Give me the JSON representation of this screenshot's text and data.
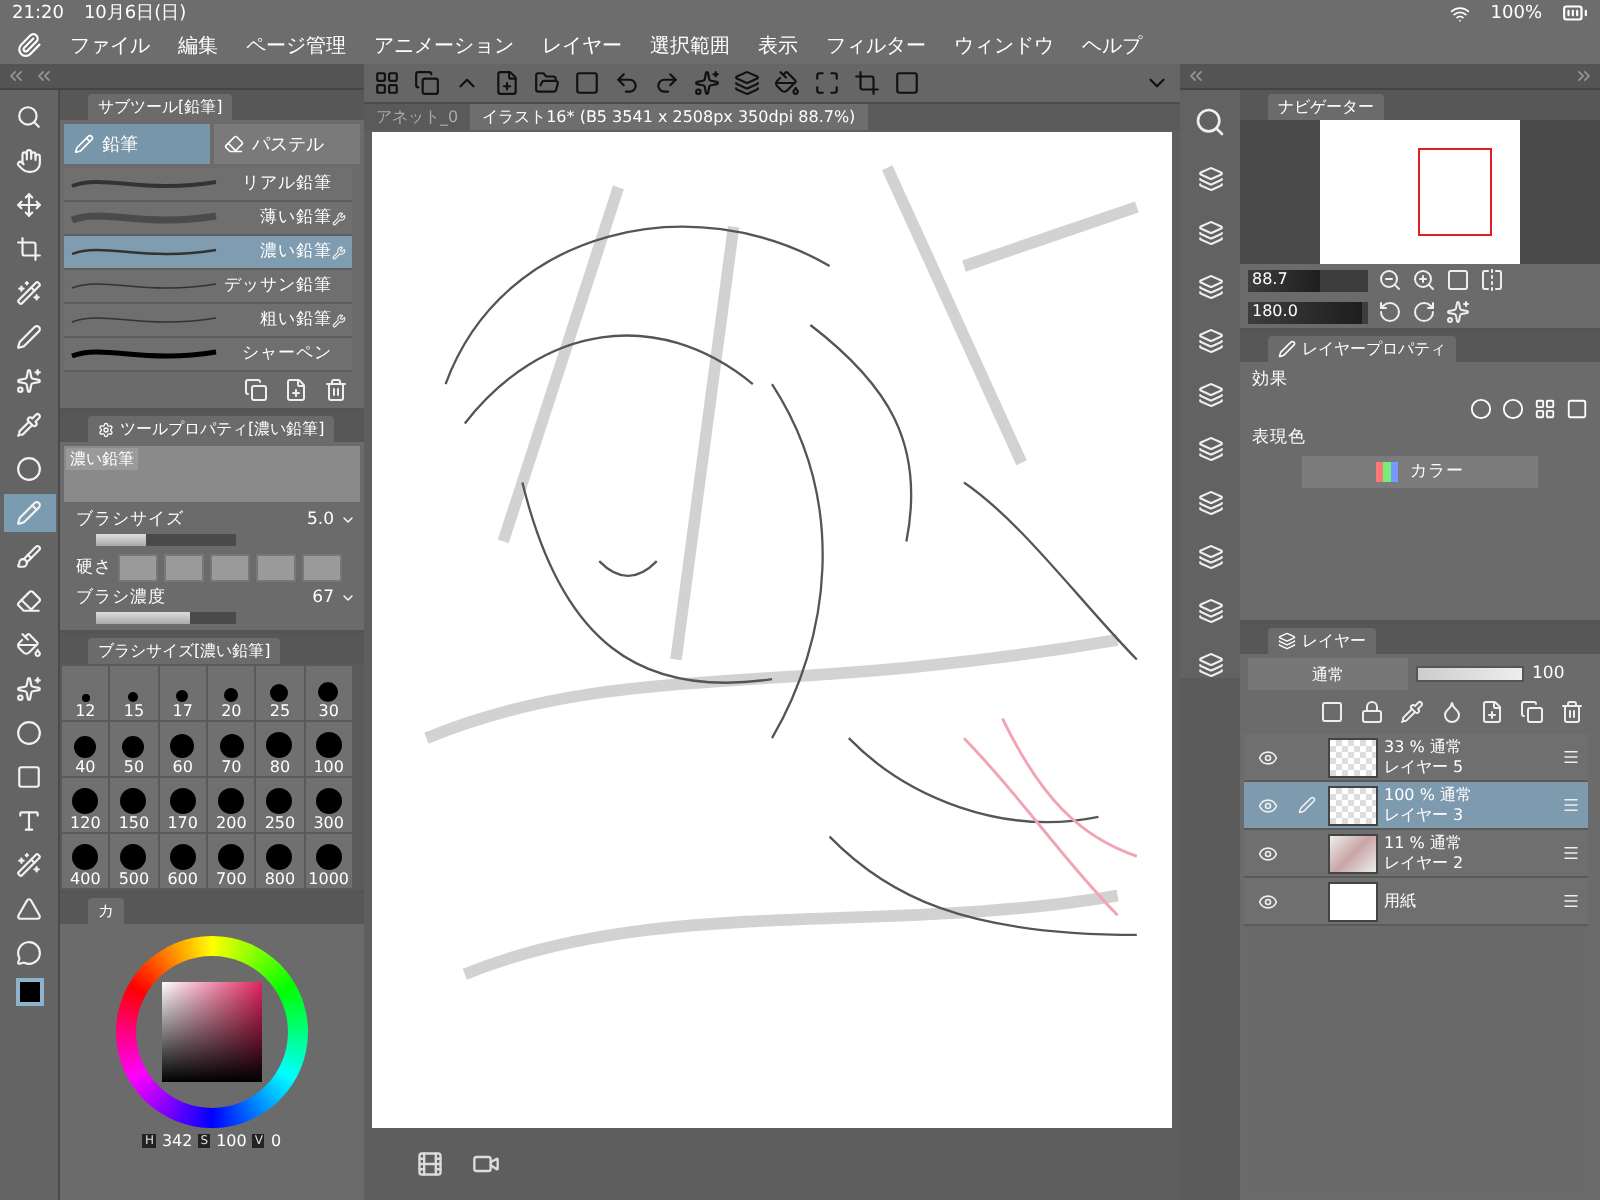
{
  "status_bar": {
    "time": "21:20",
    "date": "10月6日(日)",
    "battery": "100%"
  },
  "menu": [
    "ファイル",
    "編集",
    "ページ管理",
    "アニメーション",
    "レイヤー",
    "選択範囲",
    "表示",
    "フィルター",
    "ウィンドウ",
    "ヘルプ"
  ],
  "tools": [
    {
      "selected": false
    },
    {
      "selected": false
    },
    {
      "selected": false
    },
    {
      "selected": false
    },
    {
      "selected": false
    },
    {
      "selected": false
    },
    {
      "selected": false
    },
    {
      "selected": false
    },
    {
      "selected": false
    },
    {
      "selected": true
    },
    {
      "selected": false
    },
    {
      "selected": false
    },
    {
      "selected": false
    },
    {
      "selected": false
    },
    {
      "selected": false
    },
    {
      "selected": false
    },
    {
      "selected": false
    },
    {
      "selected": false
    },
    {
      "selected": false
    },
    {
      "selected": false
    }
  ],
  "subtool": {
    "title": "サブツール[鉛筆]",
    "groups": [
      {
        "label": "鉛筆",
        "selected": true
      },
      {
        "label": "パステル",
        "selected": false
      }
    ],
    "brushes": [
      {
        "name": "リアル鉛筆",
        "selected": false,
        "modified": false
      },
      {
        "name": "薄い鉛筆",
        "selected": false,
        "modified": true
      },
      {
        "name": "濃い鉛筆",
        "selected": true,
        "modified": true
      },
      {
        "name": "デッサン鉛筆",
        "selected": false,
        "modified": false
      },
      {
        "name": "粗い鉛筆",
        "selected": false,
        "modified": true
      },
      {
        "name": "シャーペン",
        "selected": false,
        "modified": false
      }
    ]
  },
  "tool_property": {
    "title": "ツールプロパティ[濃い鉛筆]",
    "preview_label": "濃い鉛筆",
    "props": [
      {
        "kind": "slider",
        "label": "ブラシサイズ",
        "value": "5.0",
        "level": 0.35
      },
      {
        "kind": "swatches",
        "label": "硬さ"
      },
      {
        "kind": "slider",
        "label": "ブラシ濃度",
        "value": "67",
        "level": 0.67
      }
    ]
  },
  "brush_size": {
    "title": "ブラシサイズ[濃い鉛筆]",
    "sizes": [
      "12",
      "15",
      "17",
      "20",
      "25",
      "30",
      "40",
      "50",
      "60",
      "70",
      "80",
      "100",
      "120",
      "150",
      "170",
      "200",
      "250",
      "300",
      "400",
      "500",
      "600",
      "700",
      "800",
      "1000"
    ]
  },
  "color": {
    "tab": "カ",
    "h_label": "H",
    "h": "342",
    "s_label": "S",
    "s": "100",
    "v_label": "V",
    "v": "0"
  },
  "canvas": {
    "tabs": [
      {
        "label": "アネット_0",
        "selected": false
      },
      {
        "label": "イラスト16* (B5 3541 x 2508px 350dpi 88.7%)",
        "selected": true
      }
    ]
  },
  "navigator": {
    "title": "ナビゲーター",
    "zoom": {
      "value": "88.7",
      "level": 0.6
    },
    "rotation": {
      "value": "180.0",
      "level": 0.95
    }
  },
  "layer_property": {
    "title": "レイヤープロパティ",
    "effect_label": "効果",
    "color_label": "表現色",
    "color_mode": "カラー"
  },
  "layers": {
    "title": "レイヤー",
    "blend": "通常",
    "opacity": {
      "value": "100",
      "level": 1
    },
    "items": [
      {
        "kind": "raster",
        "opacity": "33 %",
        "blend": "通常",
        "name": "レイヤー 5",
        "selected": false,
        "visible": true,
        "editing": false
      },
      {
        "kind": "raster",
        "opacity": "100 %",
        "blend": "通常",
        "name": "レイヤー 3",
        "selected": true,
        "visible": true,
        "editing": true
      },
      {
        "kind": "image",
        "opacity": "11 %",
        "blend": "通常",
        "name": "レイヤー 2",
        "selected": false,
        "visible": true,
        "editing": false
      },
      {
        "kind": "paper",
        "name": "用紙",
        "selected": false,
        "visible": true,
        "editing": false
      }
    ]
  }
}
